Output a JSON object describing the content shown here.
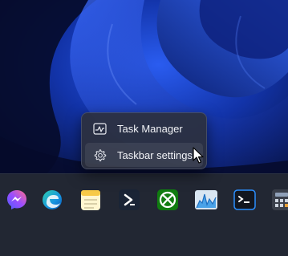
{
  "context_menu": {
    "items": [
      {
        "label": "Task Manager",
        "icon": "task-manager-icon"
      },
      {
        "label": "Taskbar settings",
        "icon": "gear-icon"
      }
    ]
  },
  "taskbar": {
    "apps": [
      {
        "name": "Messenger",
        "icon": "messenger-icon"
      },
      {
        "name": "Microsoft Edge",
        "icon": "edge-icon"
      },
      {
        "name": "Notepad",
        "icon": "notepad-icon"
      },
      {
        "name": "PowerShell",
        "icon": "powershell-icon"
      },
      {
        "name": "Xbox",
        "icon": "xbox-icon"
      },
      {
        "name": "Resource Monitor",
        "icon": "monitor-chart-icon"
      },
      {
        "name": "Terminal",
        "icon": "terminal-icon"
      },
      {
        "name": "Calculator",
        "icon": "calculator-icon"
      }
    ]
  },
  "colors": {
    "wallpaper_dark": "#070d33",
    "wallpaper_blue": "#1d4bd8",
    "menu_bg": "#2c303e",
    "taskbar_bg": "#222733"
  }
}
